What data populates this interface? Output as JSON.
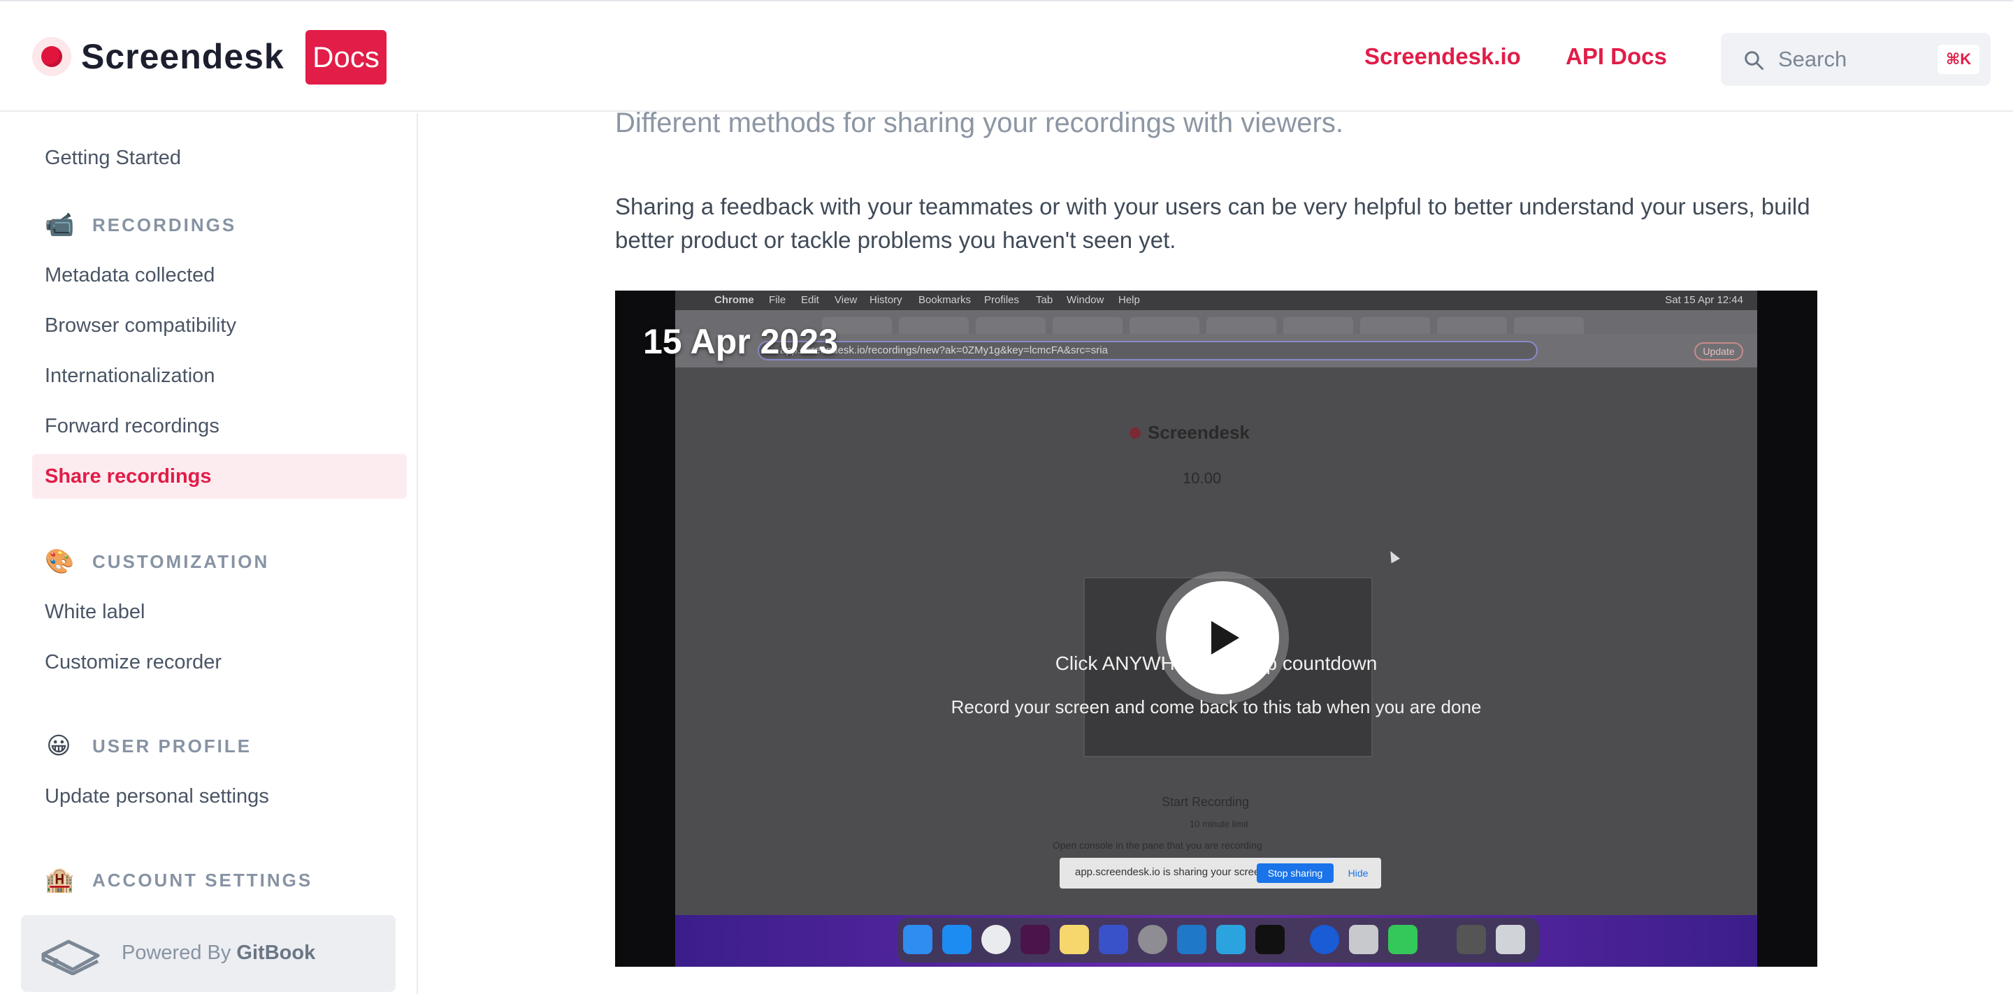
{
  "header": {
    "brand_name": "Screendesk",
    "brand_badge": "Docs",
    "nav_links": [
      "Screendesk.io",
      "API Docs"
    ],
    "search_placeholder": "Search",
    "search_shortcut": "⌘K",
    "accent_color": "#e11d48"
  },
  "sidebar": {
    "top_link": "Getting Started",
    "sections": [
      {
        "title": "RECORDINGS",
        "icon": "video-camera-icon",
        "items": [
          "Metadata collected",
          "Browser compatibility",
          "Internationalization",
          "Forward recordings",
          "Share recordings"
        ],
        "active": "Share recordings"
      },
      {
        "title": "CUSTOMIZATION",
        "icon": "palette-icon",
        "items": [
          "White label",
          "Customize recorder"
        ]
      },
      {
        "title": "USER PROFILE",
        "icon": "grinning-face-icon",
        "items": [
          "Update personal settings"
        ]
      },
      {
        "title": "ACCOUNT SETTINGS",
        "icon": "office-building-icon",
        "items": []
      }
    ],
    "powered_by": {
      "prefix": "Powered By",
      "name": "GitBook"
    }
  },
  "main": {
    "subtitle": "Different methods for sharing your recordings with viewers.",
    "paragraph": "Sharing a feedback with your teammates or with your users can be very helpful to better understand your users, build better product or tackle problems you haven't seen yet.",
    "video": {
      "date_stamp": "15 Apr 2023",
      "overlay_line1": "Click ANYWHERE to skip countdown",
      "overlay_line2": "Record your screen and come back to this tab when you are done",
      "inner_browser": {
        "menu_items": [
          "Chrome",
          "File",
          "Edit",
          "View",
          "History",
          "Bookmarks",
          "Profiles",
          "Tab",
          "Window",
          "Help"
        ],
        "clock": "Sat 15 Apr 12:44",
        "url": "app.screendesk.io/recordings/new?ak=0ZMy1g&key=lcmcFA&src=sria",
        "update_label": "Update",
        "page_logo": "Screendesk",
        "timer": "10.00",
        "start_recording": "Start Recording",
        "limit": "10 minute limit",
        "console_note": "Open console in the pane that you are recording",
        "share_notice": "app.screendesk.io is sharing your screen.",
        "stop_sharing": "Stop sharing",
        "hide": "Hide"
      }
    }
  }
}
